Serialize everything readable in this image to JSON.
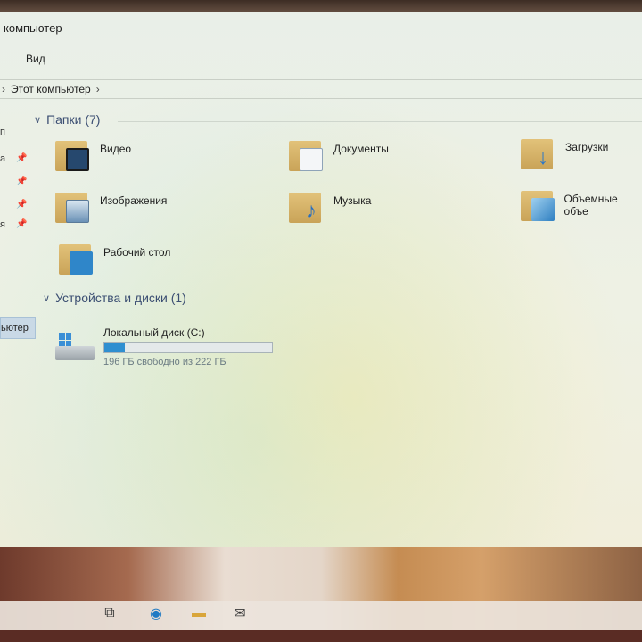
{
  "window": {
    "title": "компьютер",
    "ribbon_tab": "Вид",
    "breadcrumb": "Этот компьютер"
  },
  "sidebar": {
    "items": [
      {
        "label": "п",
        "pinned": false
      },
      {
        "label": "а",
        "pinned": true
      },
      {
        "label": "",
        "pinned": true
      },
      {
        "label": "",
        "pinned": true
      },
      {
        "label": "я",
        "pinned": true
      }
    ],
    "selected_label": "ьютер"
  },
  "folders_section": {
    "title": "Папки (7)",
    "items": [
      {
        "label": "Видео",
        "icon": "video-folder-icon",
        "color": "#3a6fb0"
      },
      {
        "label": "Документы",
        "icon": "documents-folder-icon",
        "color": "#8ea3b8"
      },
      {
        "label": "Загрузки",
        "icon": "downloads-folder-icon",
        "color": "#2c78c8"
      },
      {
        "label": "Изображения",
        "icon": "pictures-folder-icon",
        "color": "#6a91b6"
      },
      {
        "label": "Музыка",
        "icon": "music-folder-icon",
        "color": "#2a6fbf"
      },
      {
        "label": "Объемные объе",
        "icon": "3d-objects-folder-icon",
        "color": "#5fa5d8"
      },
      {
        "label": "Рабочий стол",
        "icon": "desktop-folder-icon",
        "color": "#2f86c9"
      }
    ]
  },
  "devices_section": {
    "title": "Устройства и диски (1)",
    "drive": {
      "label": "Локальный диск (C:)",
      "free_text": "196 ГБ свободно из 222 ГБ",
      "used_fraction": 0.12
    }
  },
  "taskbar": {
    "icons": [
      "task-view-icon",
      "edge-icon",
      "file-explorer-icon",
      "mail-icon"
    ]
  }
}
